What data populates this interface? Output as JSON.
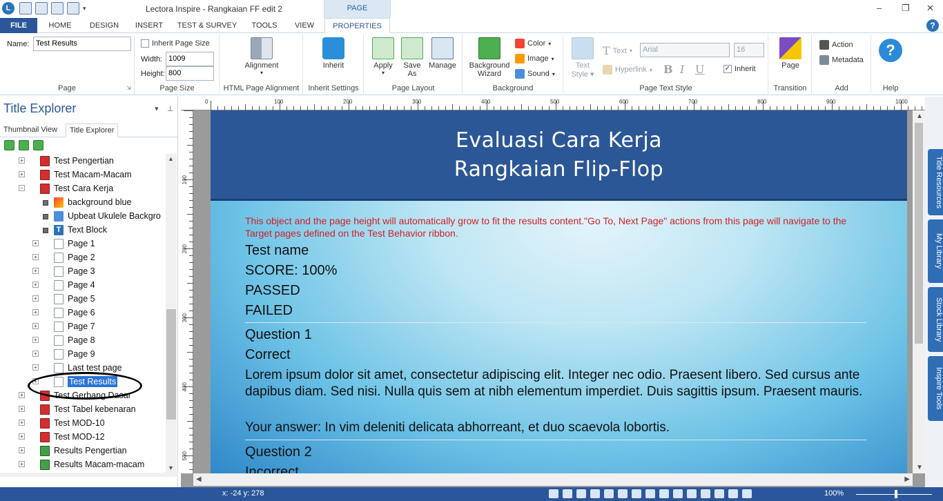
{
  "window": {
    "title": "Lectora Inspire - Rangkaian FF edit 2",
    "context_group": "PAGE"
  },
  "tabs": [
    "FILE",
    "HOME",
    "DESIGN",
    "INSERT",
    "TEST & SURVEY",
    "TOOLS",
    "VIEW",
    "PROPERTIES"
  ],
  "ribbon": {
    "page": {
      "name_label": "Name:",
      "name_value": "Test Results",
      "group": "Page"
    },
    "page_size": {
      "inherit_label": "Inherit Page Size",
      "width_label": "Width:",
      "width_value": "1009",
      "height_label": "Height:",
      "height_value": "800",
      "group": "Page Size"
    },
    "html_alignment": {
      "button": "Alignment",
      "group": "HTML Page Alignment"
    },
    "inherit": {
      "button": "Inherit",
      "group": "Inherit Settings"
    },
    "layout": {
      "apply": "Apply",
      "save_as_1": "Save",
      "save_as_2": "As",
      "manage": "Manage",
      "group": "Page Layout"
    },
    "background": {
      "wizard_1": "Background",
      "wizard_2": "Wizard",
      "color": "Color",
      "image": "Image",
      "sound": "Sound",
      "group": "Background"
    },
    "text_style": {
      "text_style_1": "Text",
      "text_style_2": "Style",
      "text": "Text",
      "hyperlink": "Hyperlink",
      "font": "Arial",
      "size": "16",
      "bold": "B",
      "italic": "I",
      "underline": "U",
      "inherit": "Inherit",
      "group": "Page Text Style"
    },
    "transition": {
      "button": "Page",
      "group": "Transition"
    },
    "add": {
      "action": "Action",
      "metadata": "Metadata",
      "group": "Add"
    },
    "help": {
      "group": "Help"
    }
  },
  "panel": {
    "title": "Title Explorer",
    "tabs": [
      "Thumbnail View",
      "Title Explorer"
    ],
    "tree": [
      {
        "label": "Test Pengertian",
        "type": "test",
        "level": 0
      },
      {
        "label": "Test Macam-Macam",
        "type": "test",
        "level": 0
      },
      {
        "label": "Test Cara Kerja",
        "type": "test",
        "level": 0,
        "expanded": true
      },
      {
        "label": "background blue",
        "type": "bg",
        "level": 1
      },
      {
        "label": "Upbeat Ukulele Backgro",
        "type": "audio",
        "level": 1
      },
      {
        "label": "Text Block",
        "type": "text",
        "level": 1
      },
      {
        "label": "Page 1",
        "type": "page",
        "level": 1
      },
      {
        "label": "Page 2",
        "type": "page",
        "level": 1
      },
      {
        "label": "Page 3",
        "type": "page",
        "level": 1
      },
      {
        "label": "Page 4",
        "type": "page",
        "level": 1
      },
      {
        "label": "Page 5",
        "type": "page",
        "level": 1
      },
      {
        "label": "Page 6",
        "type": "page",
        "level": 1
      },
      {
        "label": "Page 7",
        "type": "page",
        "level": 1
      },
      {
        "label": "Page 8",
        "type": "page",
        "level": 1
      },
      {
        "label": "Page 9",
        "type": "page",
        "level": 1
      },
      {
        "label": "Last test page",
        "type": "page",
        "level": 1
      },
      {
        "label": "Test Results",
        "type": "page",
        "level": 1,
        "selected": true
      },
      {
        "label": "Test Gerbang Dasar",
        "type": "test",
        "level": 0
      },
      {
        "label": "Test Tabel kebenaran",
        "type": "test",
        "level": 0
      },
      {
        "label": "Test MOD-10",
        "type": "test",
        "level": 0
      },
      {
        "label": "Test MOD-12",
        "type": "test",
        "level": 0
      },
      {
        "label": "Results Pengertian",
        "type": "result",
        "level": 0
      },
      {
        "label": "Results Macam-macam",
        "type": "result",
        "level": 0
      }
    ]
  },
  "ruler": {
    "h": [
      "0",
      "100",
      "200",
      "300",
      "400",
      "500",
      "600",
      "700",
      "800",
      "900",
      "1000"
    ],
    "v": [
      "100",
      "200",
      "300",
      "400",
      "500"
    ]
  },
  "page_content": {
    "title_line1": "Evaluasi Cara Kerja",
    "title_line2": "Rangkaian Flip-Flop",
    "notice": "This object and the page height will automatically grow to fit the results content.\"Go To, Next Page\" actions from this page will navigate to the Target pages defined on the Test Behavior ribbon.",
    "test_name": "Test name",
    "score": "SCORE: 100%",
    "passed": "PASSED",
    "failed": "FAILED",
    "q1": "Question 1",
    "q1_status": "Correct",
    "q1_text": "Lorem ipsum dolor sit amet, consectetur adipiscing elit. Integer nec odio. Praesent libero. Sed cursus ante dapibus diam. Sed nisi. Nulla quis sem at nibh elementum imperdiet. Duis sagittis ipsum. Praesent mauris.",
    "q1_answer": "Your answer: In vim deleniti delicata abhorreant, et duo scaevola lobortis.",
    "q2": "Question 2",
    "q2_status": "Incorrect"
  },
  "side_tabs": [
    "Title Resources",
    "My Library",
    "Stock Library",
    "Inspire Tools"
  ],
  "status": {
    "coords": "x: -24  y: 278",
    "zoom": "100%"
  },
  "colors": {
    "accent": "#2b579a",
    "header": "#2c5797",
    "notice": "#d0202a",
    "selection": "#2b73d9"
  }
}
